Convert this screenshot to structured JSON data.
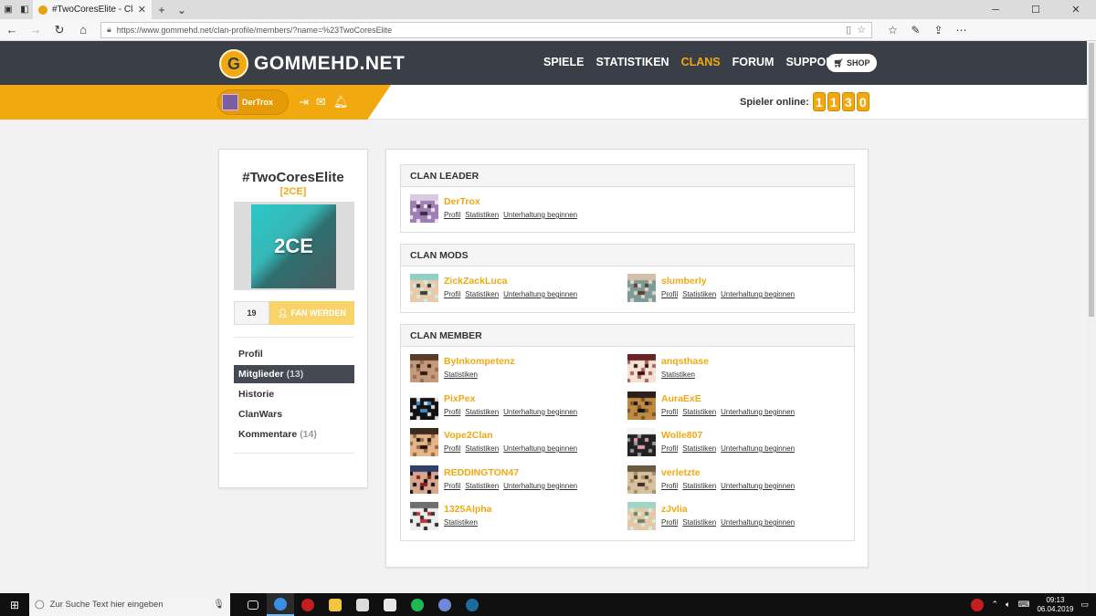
{
  "browser": {
    "tab_title": "#TwoCoresElite - Clan M",
    "url": "https://www.gommehd.net/clan-profile/members/?name=%23TwoCoresElite"
  },
  "site": {
    "logo_text": "GOMMEHD.NET",
    "logo_letter": "G",
    "nav": [
      {
        "label": "SPIELE"
      },
      {
        "label": "STATISTIKEN"
      },
      {
        "label": "CLANS"
      },
      {
        "label": "FORUM"
      },
      {
        "label": "SUPPORT"
      }
    ],
    "shop_label": "SHOP",
    "brand_color": "#f2a80f",
    "user": "DerTrox",
    "online_label": "Spieler online:",
    "online_digits": [
      "1",
      "1",
      "3",
      "0"
    ]
  },
  "clan": {
    "name": "#TwoCoresElite",
    "tag": "[2CE]",
    "image_text": "2CE",
    "fan_count": "19",
    "fan_button": "FAN WERDEN",
    "menu": [
      {
        "label": "Profil",
        "count": ""
      },
      {
        "label": "Mitglieder",
        "count": "(13)"
      },
      {
        "label": "Historie",
        "count": ""
      },
      {
        "label": "ClanWars",
        "count": ""
      },
      {
        "label": "Kommentare",
        "count": "(14)"
      }
    ]
  },
  "links": {
    "profil": "Profil",
    "statistiken": "Statistiken",
    "chat": "Unterhaltung beginnen"
  },
  "sections": {
    "leader": {
      "title": "CLAN LEADER",
      "members": [
        {
          "name": "DerTrox",
          "links": "full"
        }
      ]
    },
    "mods": {
      "title": "CLAN MODS",
      "members": [
        {
          "name": "ZickZackLuca",
          "links": "full"
        },
        {
          "name": "slumberly",
          "links": "full"
        }
      ]
    },
    "members": {
      "title": "CLAN MEMBER",
      "members": [
        {
          "name": "ByInkompetenz",
          "links": "stats"
        },
        {
          "name": "anqsthase",
          "links": "stats"
        },
        {
          "name": "PixPex",
          "links": "full"
        },
        {
          "name": "AuraExE",
          "links": "full"
        },
        {
          "name": "Vope2Clan",
          "links": "full"
        },
        {
          "name": "Wolle807",
          "links": "full"
        },
        {
          "name": "REDDINGTON47",
          "links": "full"
        },
        {
          "name": "verletzte",
          "links": "full"
        },
        {
          "name": "1325Alpha",
          "links": "stats"
        },
        {
          "name": "zJvlia",
          "links": "full"
        }
      ]
    }
  },
  "taskbar": {
    "search_placeholder": "Zur Suche Text hier eingeben",
    "time": "09:13",
    "date": "06.04.2019"
  }
}
